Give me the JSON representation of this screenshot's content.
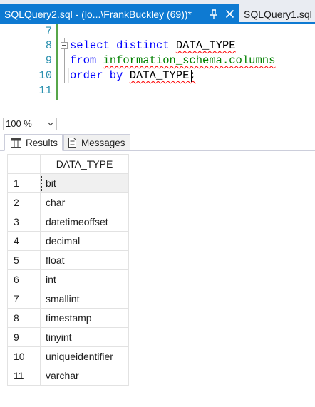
{
  "tabs": {
    "active_label": "SQLQuery2.sql - (lo...\\FrankBuckley (69))*",
    "inactive_label": "SQLQuery1.sql",
    "accent_color": "#0e7ad2"
  },
  "editor": {
    "line_numbers": [
      "7",
      "8",
      "9",
      "10",
      "11"
    ],
    "code_lines": [
      {
        "keyword": "select distinct",
        "rest": "DATA_TYPE"
      },
      {
        "keyword": "from",
        "rest": "information_schema.columns"
      },
      {
        "keyword": "order by",
        "rest": "DATA_TYPE;"
      }
    ]
  },
  "zoom": {
    "value": "100 %"
  },
  "results_tabs": {
    "results_label": "Results",
    "messages_label": "Messages"
  },
  "grid": {
    "column_header": "DATA_TYPE",
    "rows": [
      {
        "num": "1",
        "value": "bit"
      },
      {
        "num": "2",
        "value": "char"
      },
      {
        "num": "3",
        "value": "datetimeoffset"
      },
      {
        "num": "4",
        "value": "decimal"
      },
      {
        "num": "5",
        "value": "float"
      },
      {
        "num": "6",
        "value": "int"
      },
      {
        "num": "7",
        "value": "smallint"
      },
      {
        "num": "8",
        "value": "timestamp"
      },
      {
        "num": "9",
        "value": "tinyint"
      },
      {
        "num": "10",
        "value": "uniqueidentifier"
      },
      {
        "num": "11",
        "value": "varchar"
      }
    ]
  }
}
